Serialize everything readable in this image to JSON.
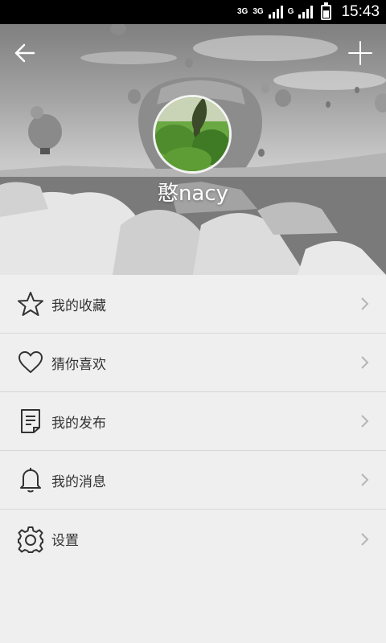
{
  "status_bar": {
    "network_1": "3G",
    "network_2": "3G",
    "network_3": "G",
    "time": "15:43"
  },
  "header": {
    "back_icon": "arrow-left-icon",
    "add_icon": "plus-icon"
  },
  "profile": {
    "username": "憨nacy"
  },
  "menu": {
    "items": [
      {
        "label": "我的收藏",
        "icon": "star-icon"
      },
      {
        "label": "猜你喜欢",
        "icon": "heart-icon"
      },
      {
        "label": "我的发布",
        "icon": "document-icon"
      },
      {
        "label": "我的消息",
        "icon": "bell-icon"
      },
      {
        "label": "设置",
        "icon": "gear-icon"
      }
    ]
  },
  "colors": {
    "background": "#efefef",
    "divider": "#d6d6d6",
    "text": "#333333",
    "status_bar": "#000000"
  }
}
